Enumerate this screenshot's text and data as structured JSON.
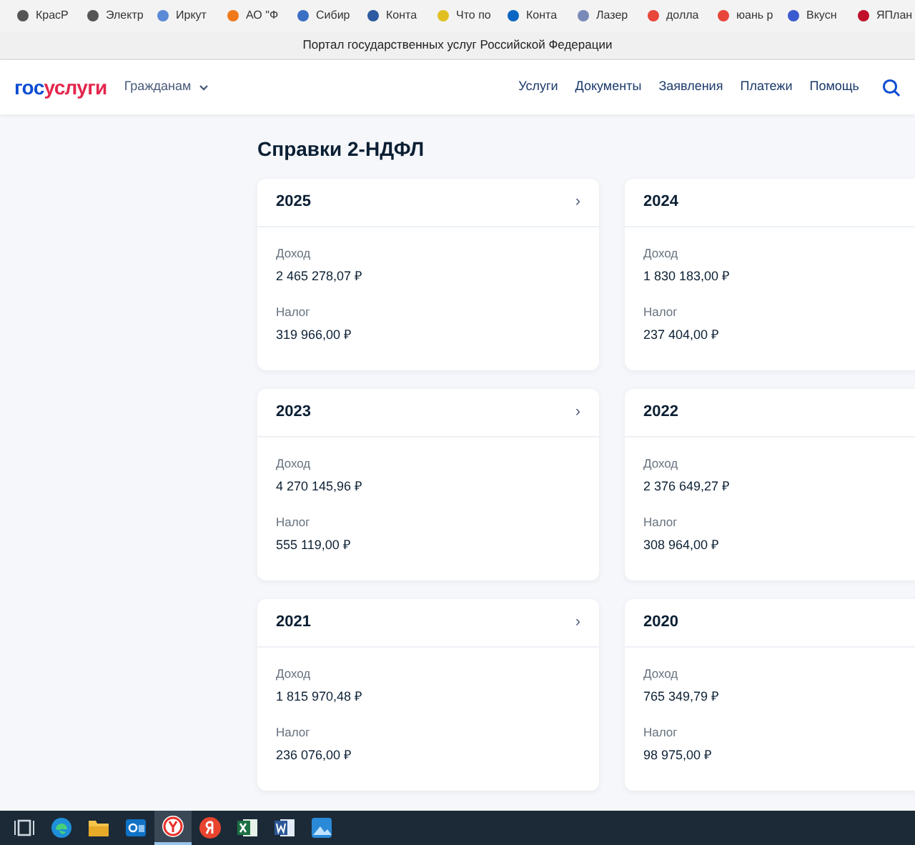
{
  "bookmarks": [
    {
      "label": "КрасР",
      "color": "#555555"
    },
    {
      "label": "Электр",
      "color": "#555555"
    },
    {
      "label": "Иркут",
      "color": "#5b8ad6"
    },
    {
      "label": "АО \"Ф",
      "color": "#f07a1a"
    },
    {
      "label": "Сибир",
      "color": "#3a6fc4"
    },
    {
      "label": "Конта",
      "color": "#2d5aa0"
    },
    {
      "label": "Что по",
      "color": "#e0c020"
    },
    {
      "label": "Конта",
      "color": "#0a66c2"
    },
    {
      "label": "Лазер",
      "color": "#7a8ab8"
    },
    {
      "label": "долла",
      "color": "#e8463a"
    },
    {
      "label": "юань р",
      "color": "#e8463a"
    },
    {
      "label": "Вкусн",
      "color": "#3a5ad0"
    },
    {
      "label": "ЯПлан",
      "color": "#c0102a"
    }
  ],
  "tab_title": "Портал государственных услуг Российской Федерации",
  "header": {
    "logo_part1": "гос",
    "logo_part2": "услуги",
    "audience": "Гражданам",
    "nav": [
      "Услуги",
      "Документы",
      "Заявления",
      "Платежи",
      "Помощь"
    ]
  },
  "page": {
    "title": "Справки 2-НДФЛ"
  },
  "cards": [
    {
      "year": "2025",
      "arrow": "›",
      "income_label": "Доход",
      "income": "2 465 278,07 ₽",
      "tax_label": "Налог",
      "tax": "319 966,00 ₽"
    },
    {
      "year": "2024",
      "income_label": "Доход",
      "income": "1 830 183,00 ₽",
      "tax_label": "Налог",
      "tax": "237 404,00 ₽"
    },
    {
      "year": "2023",
      "arrow": "›",
      "income_label": "Доход",
      "income": "4 270 145,96 ₽",
      "tax_label": "Налог",
      "tax": "555 119,00 ₽"
    },
    {
      "year": "2022",
      "income_label": "Доход",
      "income": "2 376 649,27 ₽",
      "tax_label": "Налог",
      "tax": "308 964,00 ₽"
    },
    {
      "year": "2021",
      "arrow": "›",
      "income_label": "Доход",
      "income": "1 815 970,48 ₽",
      "tax_label": "Налог",
      "tax": "236 076,00 ₽"
    },
    {
      "year": "2020",
      "income_label": "Доход",
      "income": "765 349,79 ₽",
      "tax_label": "Налог",
      "tax": "98 975,00 ₽"
    }
  ],
  "taskbar": [
    {
      "kind": "taskview",
      "selected": false
    },
    {
      "kind": "edge",
      "selected": false
    },
    {
      "kind": "folder",
      "selected": false
    },
    {
      "kind": "outlook",
      "selected": false
    },
    {
      "kind": "yabrowser",
      "selected": true
    },
    {
      "kind": "yandex",
      "selected": false
    },
    {
      "kind": "excel",
      "selected": false
    },
    {
      "kind": "word",
      "selected": false
    },
    {
      "kind": "photos",
      "selected": false
    }
  ]
}
